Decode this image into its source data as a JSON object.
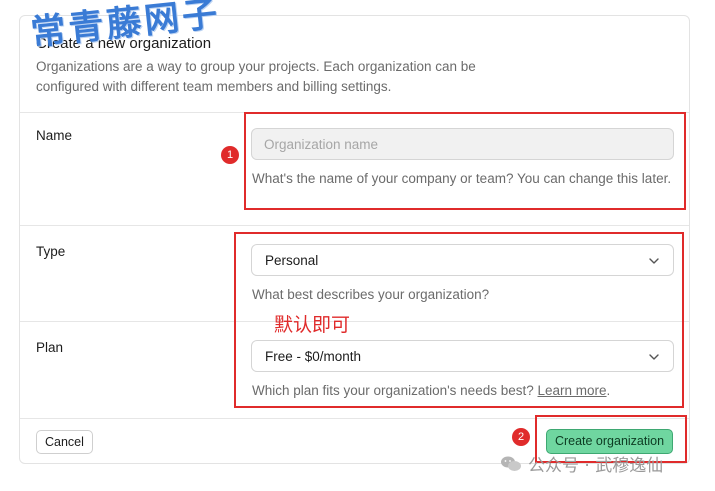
{
  "header": {
    "title": "Create a new organization",
    "subtitle": "Organizations are a way to group your projects. Each organization can be configured with different team members and billing settings.",
    "watermark": "常青藤网子"
  },
  "name_section": {
    "label": "Name",
    "placeholder": "Organization name",
    "help": "What's the name of your company or team? You can change this later."
  },
  "type_section": {
    "label": "Type",
    "value": "Personal",
    "help": "What best describes your organization?"
  },
  "plan_section": {
    "label": "Plan",
    "value": "Free - $0/month",
    "help": "Which plan fits your organization's needs best?",
    "help_link": "Learn more",
    "help_suffix": "."
  },
  "footer": {
    "cancel_label": "Cancel",
    "create_label": "Create organization"
  },
  "annotations": {
    "marker1": "1",
    "marker2": "2",
    "note": "默认即可",
    "color": "#e02b2b"
  },
  "wechat_watermark": "公众号 · 武穆逸仙",
  "colors": {
    "create_button": "#6fd6a0",
    "annotation_red": "#e02b2b"
  }
}
